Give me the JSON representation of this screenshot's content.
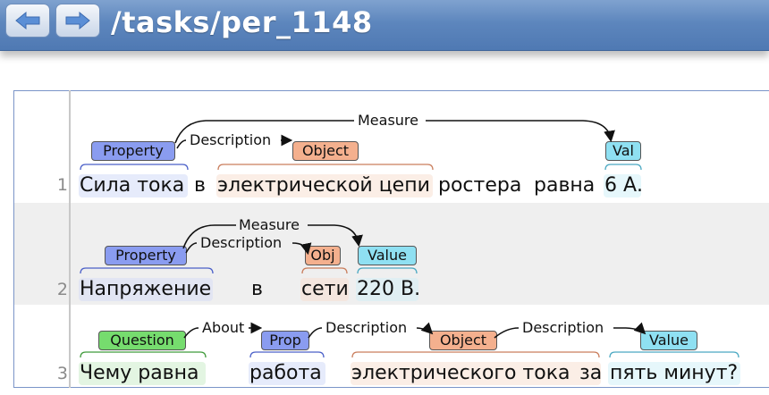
{
  "header": {
    "path": "/tasks/per_1148",
    "back_icon": "arrow-left-icon",
    "forward_icon": "arrow-right-icon"
  },
  "sentences": [
    {
      "number": "1",
      "tokens": [
        "Сила тока",
        "в",
        "электрической цепи",
        "ростера",
        "равна",
        "6 А."
      ],
      "labels": [
        "Property",
        "Object",
        "Val"
      ],
      "arcs": [
        "Measure",
        "Description"
      ]
    },
    {
      "number": "2",
      "tokens": [
        "Напряжение",
        "в",
        "сети",
        "220 В."
      ],
      "labels": [
        "Property",
        "Obj",
        "Value"
      ],
      "arcs": [
        "Measure",
        "Description"
      ]
    },
    {
      "number": "3",
      "tokens": [
        "Чему равна",
        "работа",
        "электрического тока",
        "за",
        "пять минут?"
      ],
      "labels": [
        "Question",
        "Prop",
        "Object",
        "Value"
      ],
      "arcs": [
        "About",
        "Description",
        "Description"
      ]
    }
  ],
  "colors": {
    "property": "#8a9cf0",
    "object": "#f4b08e",
    "value": "#8fe0f2",
    "question": "#76dc6e"
  }
}
